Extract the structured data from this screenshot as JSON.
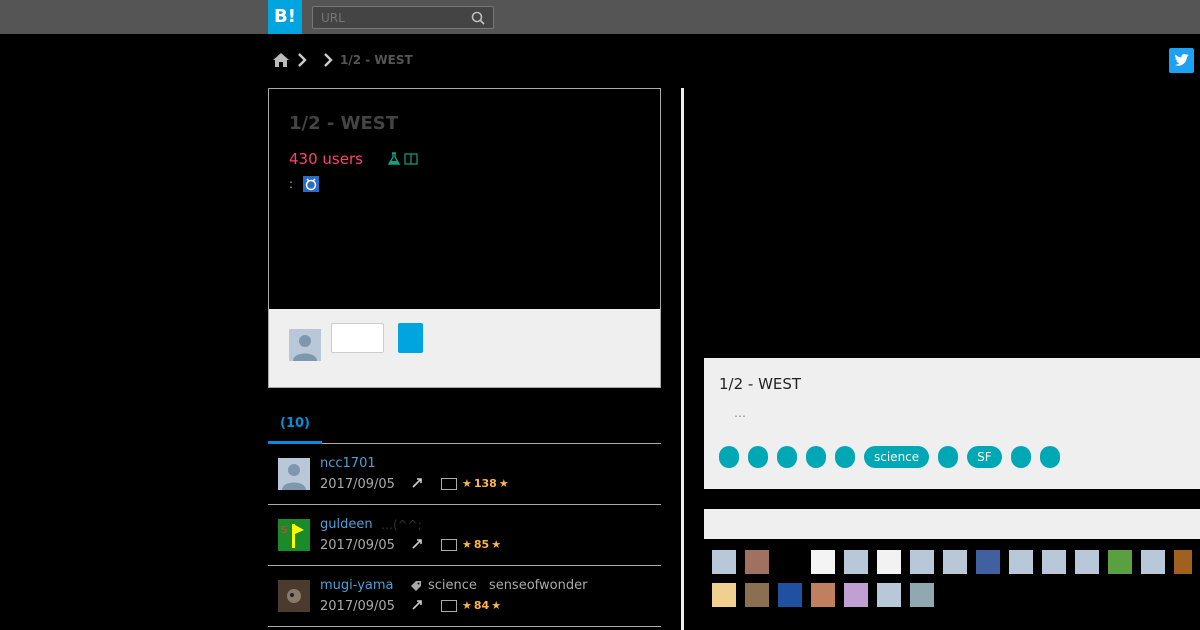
{
  "header": {
    "logo_text": "B!",
    "search_placeholder": "URL"
  },
  "breadcrumb": {
    "title": "1/2 - WEST"
  },
  "entry": {
    "title": "1/2 - WEST",
    "users": "430 users",
    "meta_prefix": ":"
  },
  "tabs": {
    "active_label": "(10)"
  },
  "bookmarks": [
    {
      "user": "ncc1701",
      "date": "2017/09/05",
      "comment": "",
      "tags": [],
      "stars": "138"
    },
    {
      "user": "guldeen",
      "date": "2017/09/05",
      "comment": "…(^^;",
      "tags": [],
      "stars": "85"
    },
    {
      "user": "mugi-yama",
      "date": "2017/09/05",
      "comment": "",
      "tags": [
        "science",
        "senseofwonder"
      ],
      "stars": "84"
    }
  ],
  "right_card": {
    "title": "1/2 - WEST",
    "description": "…",
    "tags": [
      "",
      "",
      "",
      "",
      "",
      "science",
      "",
      "SF",
      "",
      ""
    ]
  },
  "colors": {
    "accent": "#00a4de",
    "users": "#ff4166",
    "tag": "#00a7b4",
    "star": "#ffb44a"
  }
}
